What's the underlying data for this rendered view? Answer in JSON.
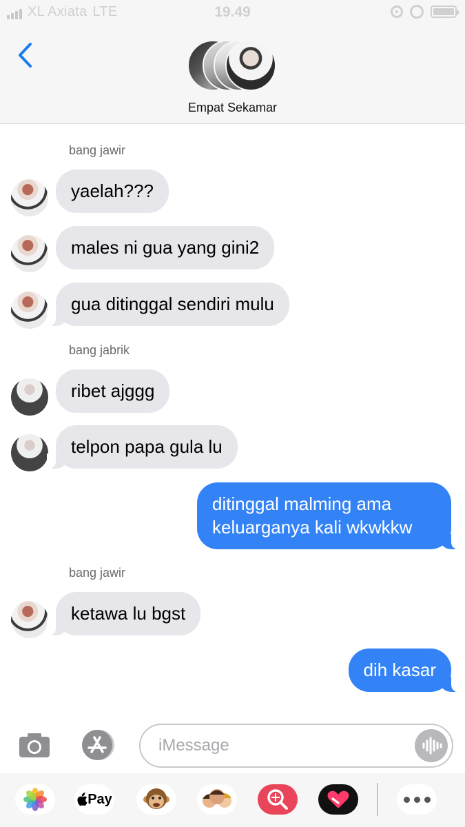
{
  "status_bar": {
    "carrier": "XL Axiata",
    "network": "LTE",
    "time": "19.49"
  },
  "header": {
    "group_name": "Empat Sekamar"
  },
  "messages": [
    {
      "sender": "bang jawir",
      "text": "yaelah???",
      "direction": "incoming"
    },
    {
      "sender": "bang jawir",
      "text": "males ni gua yang gini2",
      "direction": "incoming"
    },
    {
      "sender": "bang jawir",
      "text": "gua ditinggal sendiri mulu",
      "direction": "incoming"
    },
    {
      "sender": "bang jabrik",
      "text": "ribet ajggg",
      "direction": "incoming"
    },
    {
      "sender": "bang jabrik",
      "text": "telpon papa gula lu",
      "direction": "incoming"
    },
    {
      "sender": "",
      "text": "ditinggal malming ama",
      "text_line2": "keluarganya kali wkwkkw",
      "direction": "outgoing"
    },
    {
      "sender": "bang jawir",
      "text": "ketawa lu bgst",
      "direction": "incoming"
    },
    {
      "sender": "",
      "text": "dih kasar",
      "direction": "outgoing"
    }
  ],
  "sender_labels": [
    "bang jawir",
    "bang jabrik",
    "bang jawir"
  ],
  "input": {
    "placeholder": "iMessage",
    "value": ""
  },
  "drawer": {
    "apps": [
      "photos-icon",
      "apple-pay",
      "animoji-monkey-icon",
      "memoji-icon",
      "image-search-icon",
      "digital-touch-icon",
      "more-icon"
    ],
    "apple_pay_label": "Pay"
  },
  "colors": {
    "outgoing_bubble": "#3383f6",
    "incoming_bubble": "#e6e6eb",
    "accent": "#1a7cf5"
  }
}
